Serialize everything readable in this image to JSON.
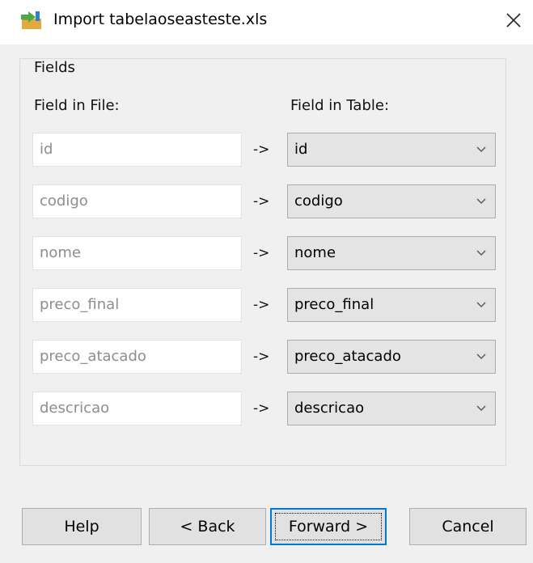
{
  "window": {
    "title": "Import tabelaoseasteste.xls",
    "close_icon": "close-icon",
    "app_icon": "import-arrow-icon"
  },
  "fields": {
    "legend": "Fields",
    "header_file": "Field in File:",
    "header_table": "Field in Table:",
    "arrow": "->",
    "rows": [
      {
        "file_field": "id",
        "table_field": "id"
      },
      {
        "file_field": "codigo",
        "table_field": "codigo"
      },
      {
        "file_field": "nome",
        "table_field": "nome"
      },
      {
        "file_field": "preco_final",
        "table_field": "preco_final"
      },
      {
        "file_field": "preco_atacado",
        "table_field": "preco_atacado"
      },
      {
        "file_field": "descricao",
        "table_field": "descricao"
      }
    ]
  },
  "buttons": {
    "help": "Help",
    "back": "< Back",
    "forward": "Forward >",
    "cancel": "Cancel"
  },
  "colors": {
    "accent": "#0078d7",
    "window_bg": "#f0f0f0",
    "titlebar_bg": "#ffffff",
    "select_bg": "#e4e4e4",
    "placeholder_text": "#8d8d8d"
  }
}
